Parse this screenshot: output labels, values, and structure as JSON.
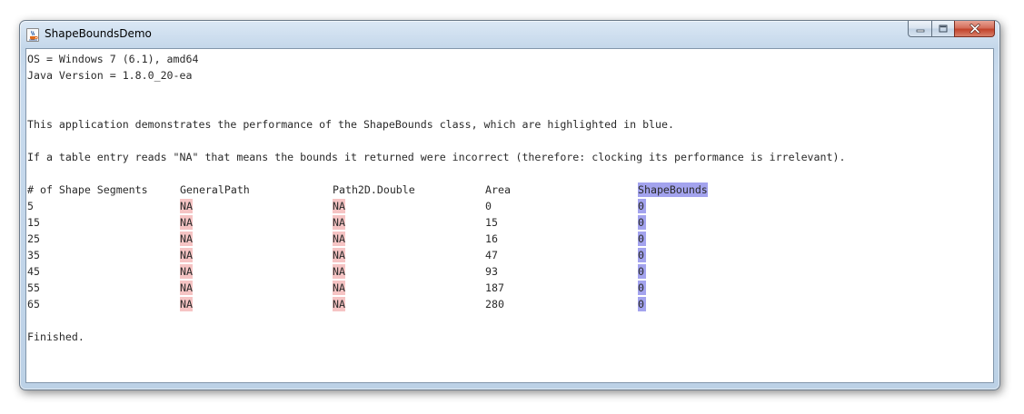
{
  "window": {
    "title": "ShapeBoundsDemo",
    "icons": {
      "app": "java-cup-icon",
      "minimize": "minimize-icon",
      "maximize": "maximize-icon",
      "close": "close-icon"
    }
  },
  "output": {
    "os_line": "OS = Windows 7 (6.1), amd64",
    "java_line": "Java Version = 1.8.0_20-ea",
    "description": "This application demonstrates the performance of the ShapeBounds class, which are highlighted in blue.",
    "note": "If a table entry reads \"NA\" that means the bounds it returned were incorrect (therefore: clocking its performance is irrelevant).",
    "finished": "Finished."
  },
  "table": {
    "headers": [
      "# of Shape Segments",
      "GeneralPath",
      "Path2D.Double",
      "Area",
      "ShapeBounds"
    ],
    "rows": [
      [
        "5",
        "NA",
        "NA",
        "0",
        "0"
      ],
      [
        "15",
        "NA",
        "NA",
        "15",
        "0"
      ],
      [
        "25",
        "NA",
        "NA",
        "16",
        "0"
      ],
      [
        "35",
        "NA",
        "NA",
        "47",
        "0"
      ],
      [
        "45",
        "NA",
        "NA",
        "93",
        "0"
      ],
      [
        "55",
        "NA",
        "NA",
        "187",
        "0"
      ],
      [
        "65",
        "NA",
        "NA",
        "280",
        "0"
      ]
    ]
  },
  "colors": {
    "na_highlight": "#f6c4c4",
    "shapebounds_highlight": "#a3a3ee"
  }
}
